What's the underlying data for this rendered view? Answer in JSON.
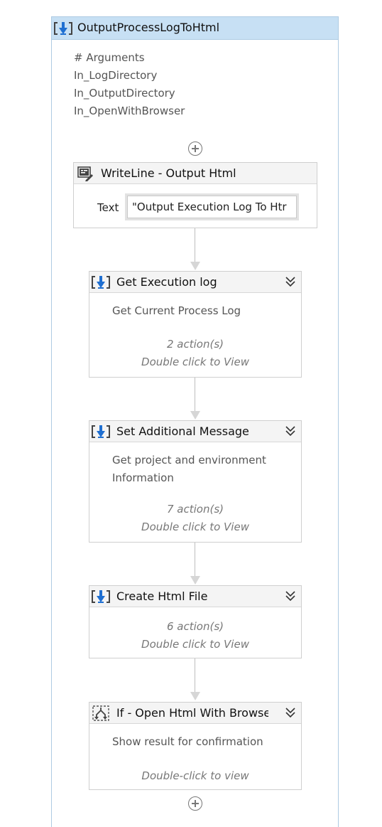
{
  "workflow": {
    "title": "OutputProcessLogToHtml",
    "arguments_header": "# Arguments",
    "arguments": [
      "In_LogDirectory",
      "In_OutputDirectory",
      "In_OpenWithBrowser"
    ]
  },
  "writeline": {
    "title": "WriteLine - Output Html",
    "text_label": "Text",
    "text_value": "\"Output Execution Log To Htr"
  },
  "activities": [
    {
      "title": "Get Execution log",
      "description": "Get Current Process Log",
      "count": "2 action(s)",
      "hint": "Double click to View"
    },
    {
      "title": "Set Additional Message",
      "description_line1": "Get project and environment",
      "description_line2": "Information",
      "count": "7 action(s)",
      "hint": "Double click to View"
    },
    {
      "title": "Create Html File",
      "count": "6 action(s)",
      "hint": "Double click to View"
    },
    {
      "title": "If - Open Html With Browser",
      "description": "Show result for confirmation",
      "hint": "Double-click to view"
    }
  ],
  "colors": {
    "header_blue": "#c7e0f4",
    "icon_blue": "#1f6fd1"
  }
}
